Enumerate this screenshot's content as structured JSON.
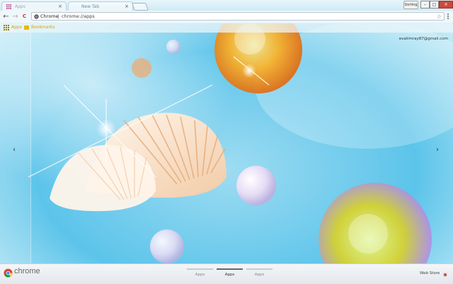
{
  "tabs": [
    {
      "label": "Apps",
      "active": true
    },
    {
      "label": "New Tab",
      "active": false
    }
  ],
  "window": {
    "profile_label": "Dorling",
    "minimize_glyph": "–",
    "maximize_glyph": "□",
    "close_glyph": "✕"
  },
  "toolbar": {
    "back_glyph": "←",
    "forward_glyph": "→",
    "reload_glyph": "C",
    "omnibox_label": "Chrome",
    "url": "chrome://apps",
    "star_glyph": "☆"
  },
  "bookmarks": {
    "apps_label": "Apps",
    "folder_label": "Bookmarks"
  },
  "ntp": {
    "user_email": "evatimray87@gmail.com",
    "prev_arrow": "‹",
    "next_arrow": "›"
  },
  "footer": {
    "brand": "chrome",
    "page_tabs": [
      {
        "label": "Apps",
        "active": false
      },
      {
        "label": "Apps",
        "active": true
      },
      {
        "label": "Apps",
        "active": false
      }
    ],
    "webstore_label": "Web Store"
  },
  "colors": {
    "accent_close": "#c94a3e",
    "bookmark_text": "#d9a200"
  },
  "icons": [
    "chrome-icon",
    "star-icon",
    "menu-icon",
    "apps-grid-icon",
    "folder-icon",
    "webstore-icon"
  ]
}
